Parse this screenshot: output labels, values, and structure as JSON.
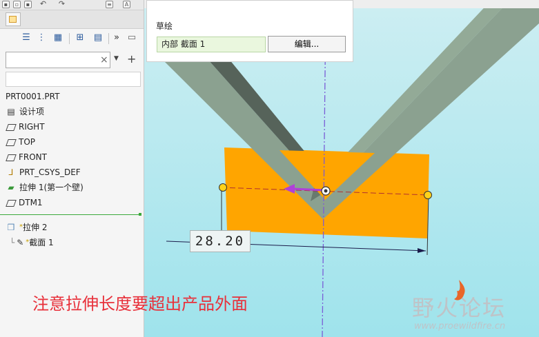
{
  "navigator": {
    "search_value": "",
    "tree": [
      {
        "label": "PRT0001.PRT",
        "icon": "part-icon"
      },
      {
        "label": "设计项",
        "icon": "design-items-icon"
      },
      {
        "label": "RIGHT",
        "icon": "datum-plane-icon"
      },
      {
        "label": "TOP",
        "icon": "datum-plane-icon"
      },
      {
        "label": "FRONT",
        "icon": "datum-plane-icon"
      },
      {
        "label": "PRT_CSYS_DEF",
        "icon": "csys-icon"
      },
      {
        "label": "拉伸 1(第一个壁)",
        "icon": "extrude-icon"
      },
      {
        "label": "DTM1",
        "icon": "datum-plane-icon"
      },
      {
        "label": "拉伸 2",
        "icon": "extrude-new-icon",
        "marker": "*"
      },
      {
        "label": "截面 1",
        "icon": "sketch-icon",
        "marker": "*"
      }
    ]
  },
  "sketch_panel": {
    "title": "草绘",
    "section_value": "内部 截面 1",
    "edit_button": "编辑..."
  },
  "viewport": {
    "dimension_value": "28.20",
    "annotation": "注意拉伸长度要超出产品外面",
    "colors": {
      "sketch_fill": "#ffa500",
      "part_dark": "#56635a",
      "part_light": "#8ba190",
      "background_top": "#cdeef2",
      "background_bottom": "#9fe3ec",
      "annotation_text": "#e8303a"
    }
  },
  "watermark": {
    "name": "野火论坛",
    "url": "www.proewildfire.cn"
  }
}
